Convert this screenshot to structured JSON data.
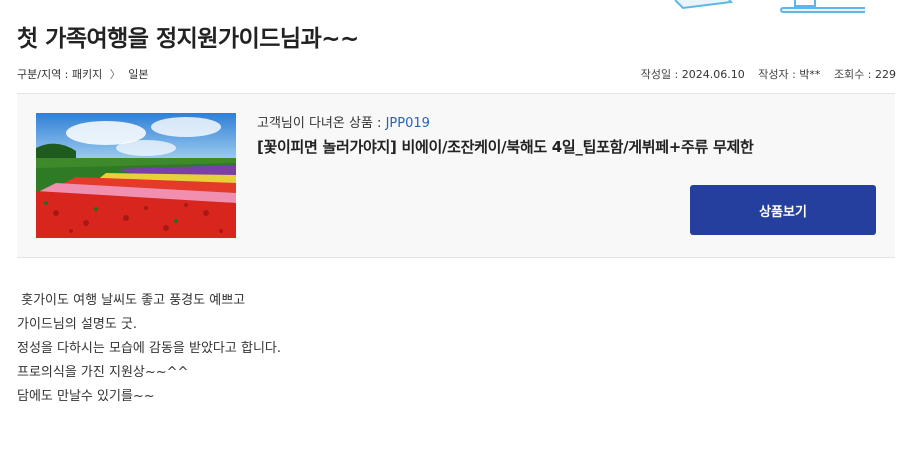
{
  "post": {
    "title": "첫 가족여행을 정지원가이드님과~~",
    "category_label": "구분/지역 : 패키지",
    "category_sep": "〉",
    "region": "일본",
    "date_label": "작성일 :",
    "date": "2024.06.10",
    "author_label": "작성자 :",
    "author": "박**",
    "views_label": "조회수 :",
    "views": "229"
  },
  "product": {
    "ref_label": "고객님이 다녀온 상품 :",
    "code": "JPP019",
    "name": "[꽃이피면 놀러가야지] 비에이/조잔케이/북해도 4일_팁포함/게뷔페+주류 무제한",
    "button_label": "상품보기",
    "image_icon": "flower-field-photo"
  },
  "review": {
    "lines": [
      " 홋가이도 여행 날씨도 좋고 풍경도 예쁘고",
      "가이드님의 설명도 굿.",
      "정성을 다하시는 모습에 감동을 받았다고 합니다.",
      "프로의식을 가진 지원상~~^^",
      "담에도 만날수 있기를~~"
    ]
  },
  "colors": {
    "accent": "#253f9e",
    "code_blue": "#2a62b5",
    "panel_bg": "#f8f8f8"
  }
}
